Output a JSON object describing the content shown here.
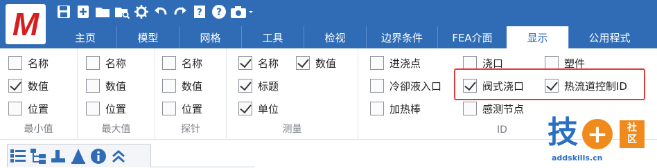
{
  "app": {
    "logo_letter": "M",
    "accent_color": "#2f6cb5",
    "logo_color": "#d42020"
  },
  "quick_access": [
    {
      "icon": "save-icon"
    },
    {
      "icon": "new-icon"
    },
    {
      "icon": "open-folder-icon"
    },
    {
      "icon": "search-folder-icon"
    },
    {
      "icon": "gear-icon"
    },
    {
      "icon": "undo-icon"
    },
    {
      "icon": "redo-icon"
    },
    {
      "icon": "help-book-icon"
    },
    {
      "icon": "help-icon"
    },
    {
      "icon": "camera-icon"
    }
  ],
  "tabs": [
    {
      "label": "主页",
      "active": false
    },
    {
      "label": "模型",
      "active": false
    },
    {
      "label": "网格",
      "active": false
    },
    {
      "label": "工具",
      "active": false
    },
    {
      "label": "检视",
      "active": false
    },
    {
      "label": "边界条件",
      "active": false
    },
    {
      "label": "FEA介面",
      "active": false
    },
    {
      "label": "显示",
      "active": true
    },
    {
      "label": "公用程式",
      "active": false
    }
  ],
  "groups": {
    "min": {
      "label": "最小值",
      "items": [
        {
          "label": "名称",
          "checked": false
        },
        {
          "label": "数值",
          "checked": true
        },
        {
          "label": "位置",
          "checked": false
        }
      ]
    },
    "max": {
      "label": "最大值",
      "items": [
        {
          "label": "名称",
          "checked": false
        },
        {
          "label": "数值",
          "checked": false
        },
        {
          "label": "位置",
          "checked": false
        }
      ]
    },
    "probe": {
      "label": "探针",
      "items": [
        {
          "label": "名称",
          "checked": false
        },
        {
          "label": "数值",
          "checked": false
        },
        {
          "label": "位置",
          "checked": false
        }
      ]
    },
    "measure": {
      "label": "测量",
      "items": [
        {
          "label": "名称",
          "checked": true
        },
        {
          "label": "数值",
          "checked": true
        },
        {
          "label": "标题",
          "checked": true
        },
        {
          "label": "单位",
          "checked": true
        }
      ]
    },
    "id": {
      "label": "ID",
      "items": [
        {
          "label": "进浇点",
          "checked": false
        },
        {
          "label": "浇口",
          "checked": false
        },
        {
          "label": "塑件",
          "checked": false
        },
        {
          "label": "冷卻液入口",
          "checked": false
        },
        {
          "label": "阀式浇口",
          "checked": true
        },
        {
          "label": "热流道控制ID",
          "checked": true
        },
        {
          "label": "加热棒",
          "checked": false
        },
        {
          "label": "感测节点",
          "checked": false
        }
      ]
    }
  },
  "bottom_tools": [
    {
      "icon": "list-icon"
    },
    {
      "icon": "tree-icon"
    },
    {
      "icon": "part-icon"
    },
    {
      "icon": "cone-icon"
    },
    {
      "icon": "info-icon"
    },
    {
      "icon": "collapse-icon"
    }
  ],
  "watermark": {
    "main": "技",
    "plus": "+",
    "badge_top": "社",
    "badge_bottom": "区",
    "url": "addskills.cn"
  }
}
